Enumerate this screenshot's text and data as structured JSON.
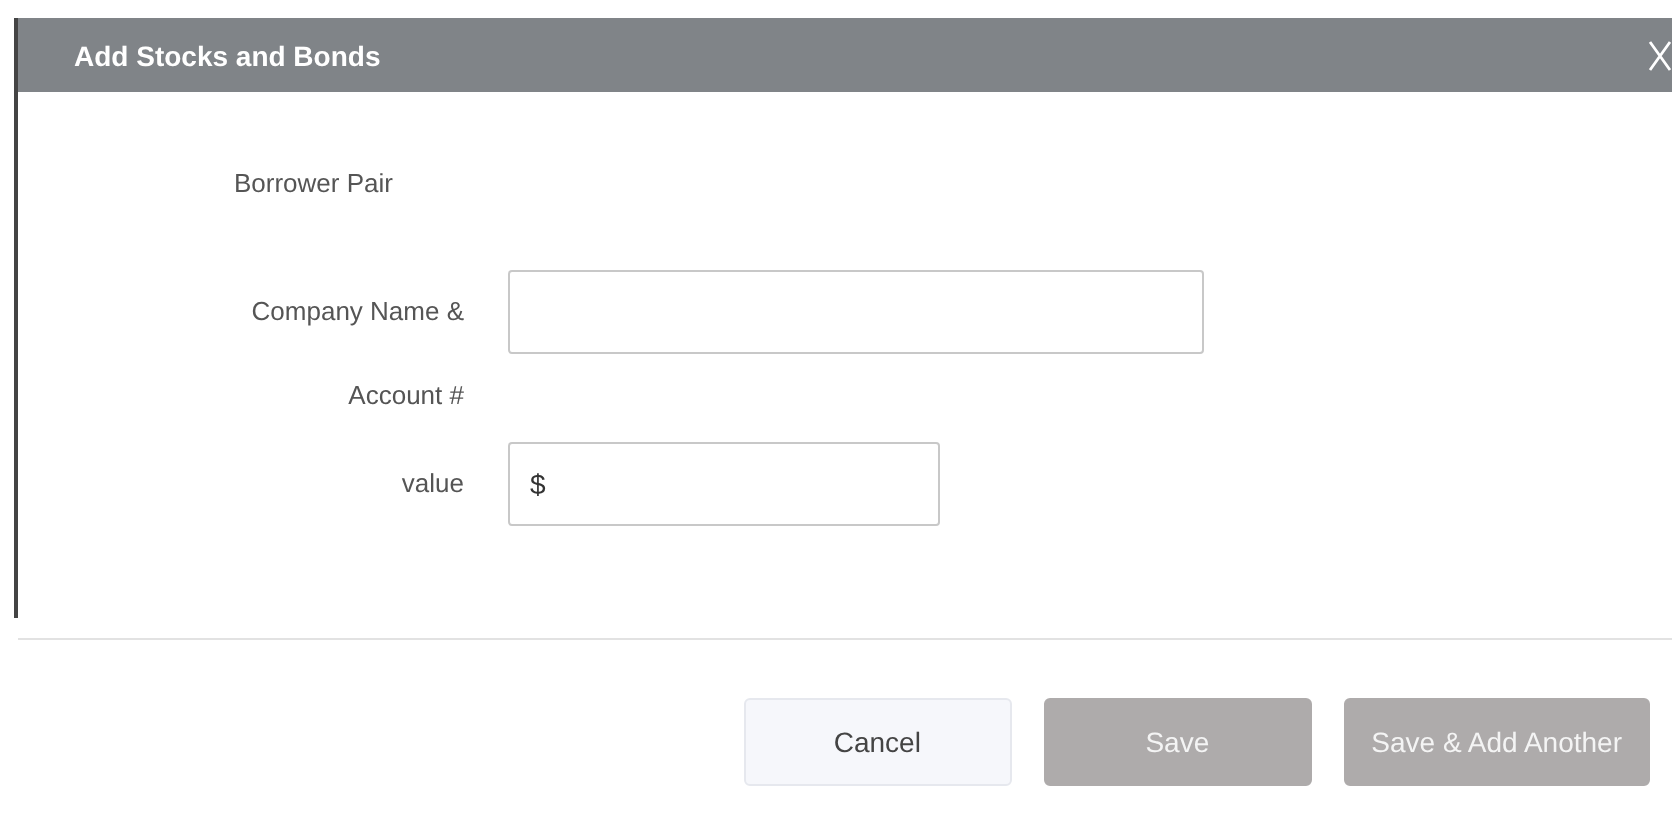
{
  "dialog": {
    "title": "Add Stocks and Bonds"
  },
  "rows": [
    {
      "kind": "heading",
      "label_lines": [
        "Borrower Pair"
      ]
    },
    {
      "kind": "field",
      "label_lines": [
        "Company Name &",
        "Account #"
      ],
      "value": "",
      "wide": true
    },
    {
      "kind": "field",
      "label_lines": [
        "value"
      ],
      "value": "$",
      "wide": false
    }
  ],
  "buttons": [
    {
      "label": "Cancel",
      "disabled": false
    },
    {
      "label": "Save",
      "disabled": true
    },
    {
      "label": "Save & Add Another",
      "disabled": true
    }
  ]
}
